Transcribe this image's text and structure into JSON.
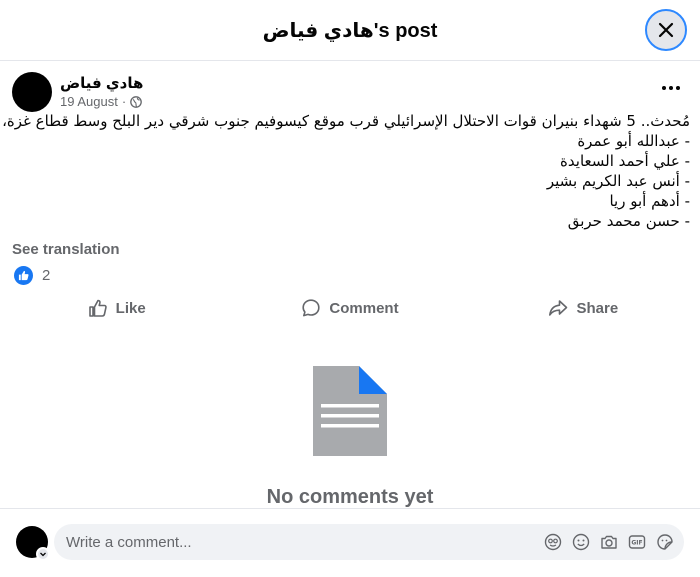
{
  "header": {
    "title": "هادي فياض's post"
  },
  "post": {
    "author": "هادي فياض",
    "date": "19 August",
    "meta_separator": "·",
    "lines": [
      "مُحدث.. 5 شهداء بنيران قوات الاحتلال الإسرائيلي قرب موقع كيسوفيم جنوب شرقي دير البلح وسط قطاع غزة، هم:",
      "- عبدالله أبو عمرة",
      "- علي أحمد السعايدة",
      "- أنس عبد الكريم بشير",
      "- أدهم أبو ريا",
      "- حسن محمد حربق"
    ],
    "see_translation": "See translation",
    "reaction_count": "2"
  },
  "actions": {
    "like": "Like",
    "comment": "Comment",
    "share": "Share"
  },
  "comments": {
    "empty_text": "No comments yet"
  },
  "composer": {
    "placeholder": "Write a comment..."
  },
  "colors": {
    "accent": "#1877f2",
    "muted": "#65676b",
    "focus_ring": "#2d88ff",
    "doc_gray": "#a8aaad",
    "doc_corner": "#1877f2"
  }
}
